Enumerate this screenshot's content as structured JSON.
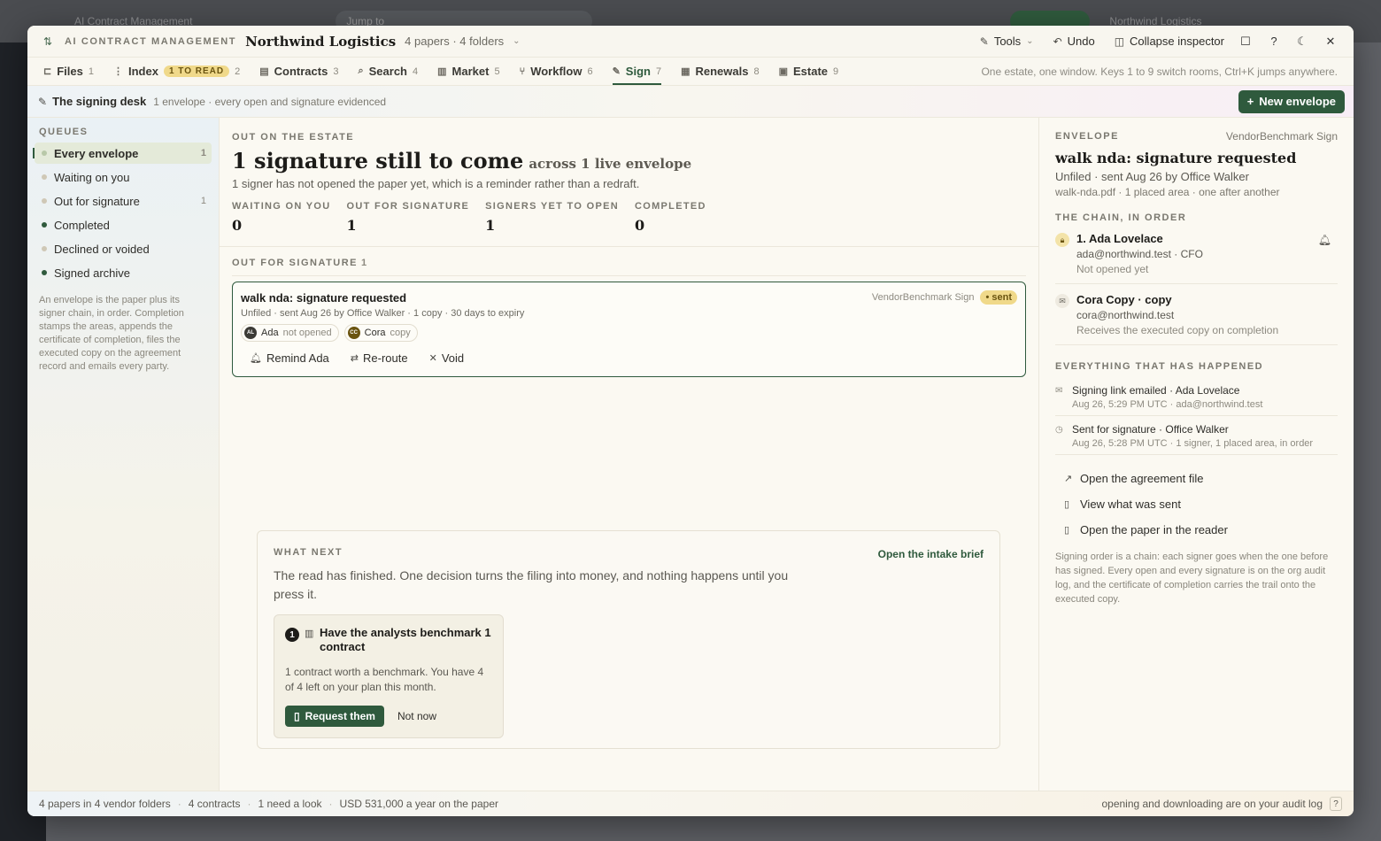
{
  "background": {
    "app_title": "AI Contract Management",
    "search_placeholder": "Jump to",
    "org": "Northwind Logistics"
  },
  "titlebar": {
    "app_name": "AI CONTRACT MANAGEMENT",
    "org": "Northwind Logistics",
    "meta": "4 papers · 4 folders",
    "tools": "Tools",
    "undo": "Undo",
    "collapse": "Collapse inspector"
  },
  "tabs": [
    {
      "label": "Files",
      "num": "1",
      "icon": "files-icon"
    },
    {
      "label": "Index",
      "badge": "1 TO READ",
      "num": "2",
      "icon": "index-icon"
    },
    {
      "label": "Contracts",
      "num": "3",
      "icon": "contracts-icon"
    },
    {
      "label": "Search",
      "num": "4",
      "icon": "search-icon"
    },
    {
      "label": "Market",
      "num": "5",
      "icon": "chart-icon"
    },
    {
      "label": "Workflow",
      "num": "6",
      "icon": "workflow-icon"
    },
    {
      "label": "Sign",
      "num": "7",
      "icon": "pen-icon",
      "active": true
    },
    {
      "label": "Renewals",
      "num": "8",
      "icon": "calendar-icon"
    },
    {
      "label": "Estate",
      "num": "9",
      "icon": "building-icon"
    }
  ],
  "tabs_hint": "One estate, one window. Keys 1 to 9 switch rooms, Ctrl+K jumps anywhere.",
  "subhead": {
    "title": "The signing desk",
    "desc": "1 envelope · every open and signature evidenced",
    "new_envelope": "New envelope"
  },
  "queues": {
    "title": "QUEUES",
    "items": [
      {
        "label": "Every envelope",
        "count": "1"
      },
      {
        "label": "Waiting on you",
        "count": ""
      },
      {
        "label": "Out for signature",
        "count": "1"
      },
      {
        "label": "Completed",
        "count": ""
      },
      {
        "label": "Declined or voided",
        "count": ""
      },
      {
        "label": "Signed archive",
        "count": ""
      }
    ],
    "note": "An envelope is the paper plus its signer chain, in order. Completion stamps the areas, appends the certificate of completion, files the executed copy on the agreement record and emails every party."
  },
  "overview": {
    "eyebrow": "OUT ON THE ESTATE",
    "headline": "1 signature still to come",
    "headline_sub": "across 1 live envelope",
    "sub": "1 signer has not opened the paper yet, which is a reminder rather than a redraft.",
    "stats": [
      {
        "label": "WAITING ON YOU",
        "value": "0"
      },
      {
        "label": "OUT FOR SIGNATURE",
        "value": "1"
      },
      {
        "label": "SIGNERS YET TO OPEN",
        "value": "1"
      },
      {
        "label": "COMPLETED",
        "value": "0"
      }
    ]
  },
  "out_section": {
    "label": "OUT FOR SIGNATURE",
    "count": "1"
  },
  "envelope_card": {
    "title": "walk nda: signature requested",
    "vendor": "VendorBenchmark Sign",
    "status": "• sent",
    "meta": "Unfiled · sent Aug 26 by Office Walker · 1 copy · 30 days to expiry",
    "chips": [
      {
        "initials": "AL",
        "name": "Ada",
        "status": "not opened"
      },
      {
        "initials": "CC",
        "name": "Cora",
        "status": "copy"
      }
    ],
    "actions": {
      "remind": "Remind Ada",
      "reroute": "Re-route",
      "void": "Void"
    }
  },
  "next": {
    "eyebrow": "WHAT NEXT",
    "link": "Open the intake brief",
    "text": "The read has finished. One decision turns the filing into money, and nothing happens until you press it.",
    "offer": {
      "num": "1",
      "title": "Have the analysts benchmark 1 contract",
      "desc": "1 contract worth a benchmark. You have 4 of 4 left on your plan this month.",
      "primary": "Request them",
      "secondary": "Not now"
    }
  },
  "inspector": {
    "eyebrow": "ENVELOPE",
    "vendor": "VendorBenchmark Sign",
    "title": "walk nda: signature requested",
    "meta": "Unfiled · sent Aug 26 by Office Walker",
    "meta2": "walk-nda.pdf · 1 placed area · one after another",
    "chain_title": "THE CHAIN, IN ORDER",
    "signers": [
      {
        "name": "1. Ada Lovelace",
        "line1": "ada@northwind.test · CFO",
        "line2": "Not opened yet"
      },
      {
        "name": "Cora Copy · copy",
        "line1": "cora@northwind.test",
        "line2": "Receives the executed copy on completion"
      }
    ],
    "history_title": "EVERYTHING THAT HAS HAPPENED",
    "events": [
      {
        "t1": "Signing link emailed · Ada Lovelace",
        "t2": "Aug 26, 5:29 PM UTC · ada@northwind.test"
      },
      {
        "t1": "Sent for signature · Office Walker",
        "t2": "Aug 26, 5:28 PM UTC · 1 signer, 1 placed area, in order"
      }
    ],
    "links": [
      "Open the agreement file",
      "View what was sent",
      "Open the paper in the reader"
    ],
    "note": "Signing order is a chain: each signer goes when the one before has signed. Every open and every signature is on the org audit log, and the certificate of completion carries the trail onto the executed copy."
  },
  "statusbar": {
    "items": [
      "4 papers in 4 vendor folders",
      "4 contracts",
      "1 need a look",
      "USD 531,000 a year on the paper"
    ],
    "right": "opening and downloading are on your audit log",
    "help": "?"
  }
}
